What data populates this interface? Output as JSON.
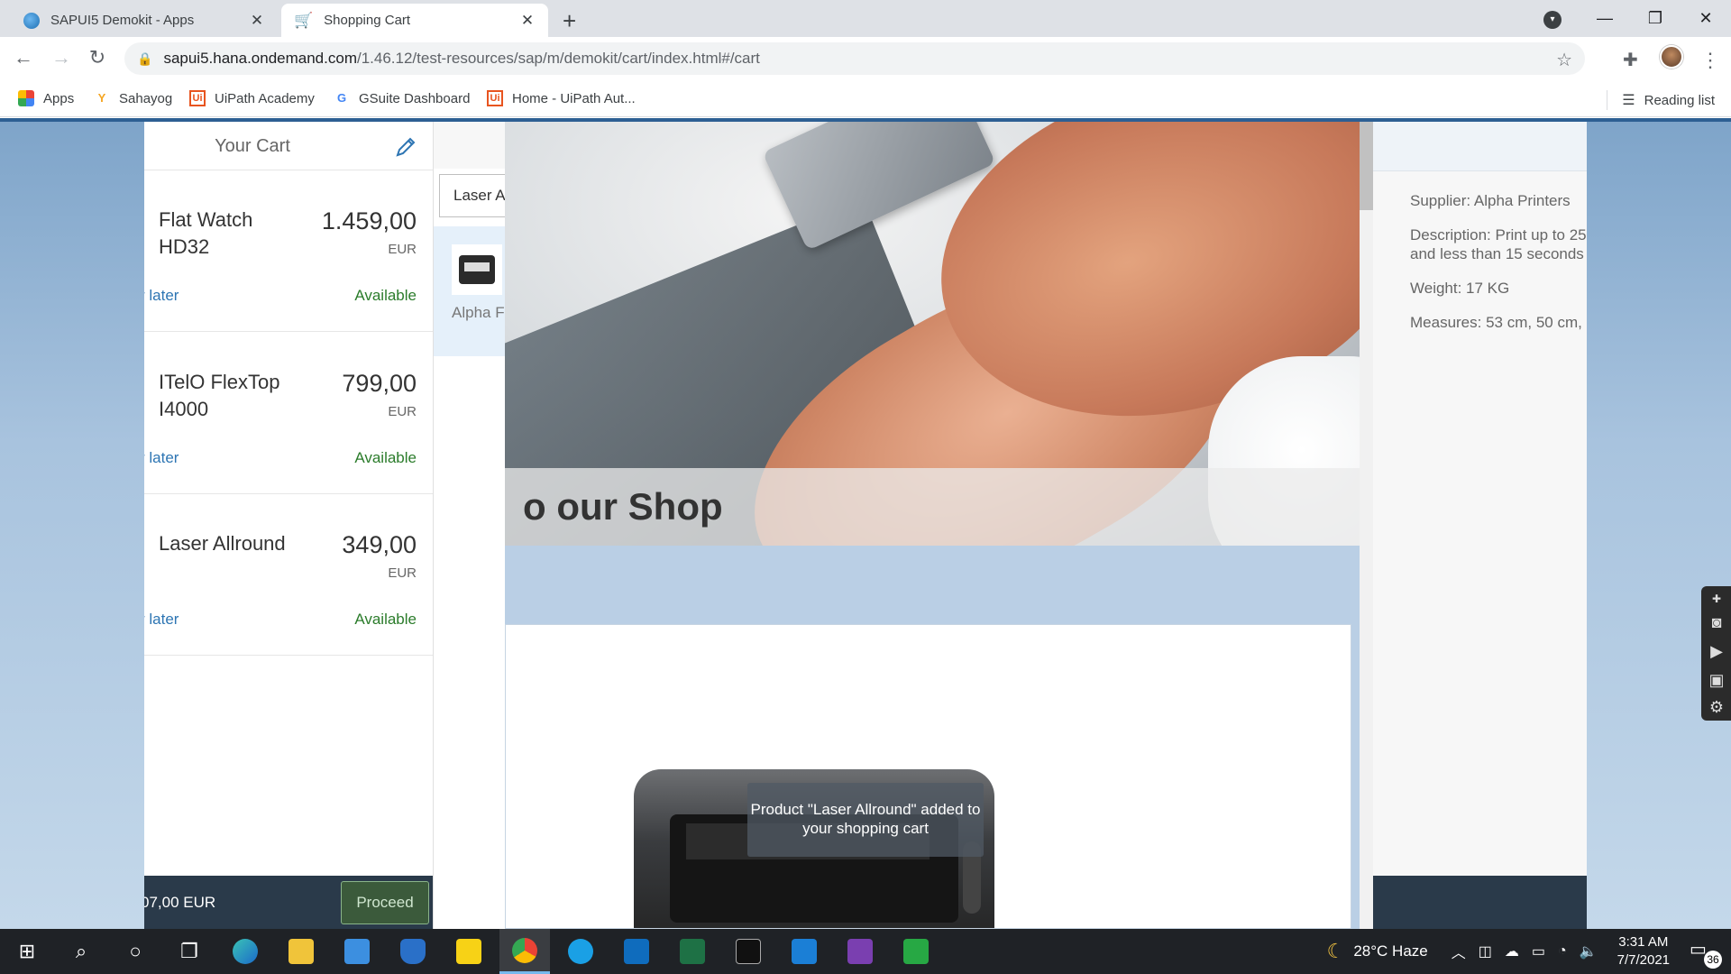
{
  "browser": {
    "tabs": [
      {
        "title": "SAPUI5 Demokit - Apps",
        "active": false
      },
      {
        "title": "Shopping Cart",
        "active": true
      }
    ],
    "url_host": "sapui5.hana.ondemand.com",
    "url_path": "/1.46.12/test-resources/sap/m/demokit/cart/index.html#/cart",
    "bookmarks": [
      "Apps",
      "Sahayog",
      "UiPath Academy",
      "GSuite Dashboard",
      "Home - UiPath Aut..."
    ],
    "reading_list": "Reading list"
  },
  "cart": {
    "title": "Your Cart",
    "items": [
      {
        "name": "Flat Watch HD32",
        "price": "1.459,00",
        "currency": "EUR",
        "later_link": "r later",
        "status": "Available"
      },
      {
        "name": "ITelO FlexTop I4000",
        "price": "799,00",
        "currency": "EUR",
        "later_link": "r later",
        "status": "Available"
      },
      {
        "name": "Laser Allround",
        "price": "349,00",
        "currency": "EUR",
        "later_link": "r later",
        "status": "Available"
      }
    ],
    "total": "07,00 EUR",
    "proceed_label": "Proceed"
  },
  "catalog": {
    "search_value": "Laser A",
    "selected_supplier": "Alpha F"
  },
  "home": {
    "hero_caption": "o our Shop",
    "toast": "Product \"Laser Allround\" added to your shopping cart"
  },
  "details": {
    "supplier": "Supplier: Alpha Printers",
    "description_line1": "Description: Print up to 25",
    "description_line2": "and less than 15 seconds",
    "weight": "Weight: 17 KG",
    "measures": "Measures: 53 cm, 50 cm,"
  },
  "taskbar": {
    "weather": "28°C  Haze",
    "time": "3:31 AM",
    "date": "7/7/2021",
    "notifications": "36"
  },
  "colors": {
    "link": "#2d75b3",
    "available": "#2b7c2b",
    "footer": "#2a3a4a",
    "accent": "#2d5f93"
  }
}
